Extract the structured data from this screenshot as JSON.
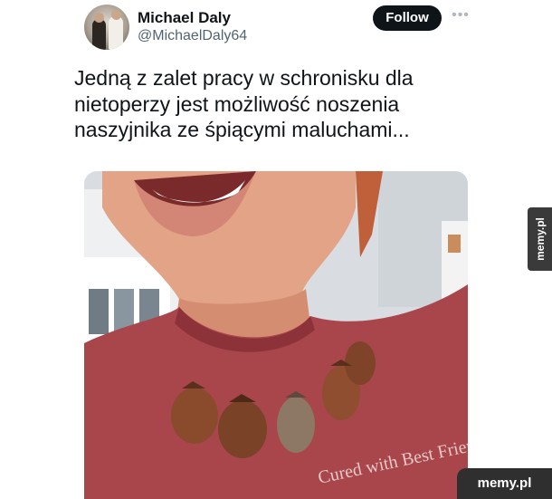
{
  "tweet": {
    "author": {
      "display_name": "Michael Daly",
      "handle": "@MichaelDaly64",
      "avatar_icon": "profile-photo"
    },
    "follow_label": "Follow",
    "more_icon": "more-horizontal-icon",
    "more_glyph": "•••",
    "text": "Jedną z zalet pracy w schronisku dla\nnietoperzy jest możliwość noszenia\nnaszyjnika ze śpiącymi maluchami...",
    "media": {
      "description_icon": "photo",
      "shirt_print": "Cured with Best Friends"
    }
  },
  "watermarks": {
    "side": "memy.pl",
    "corner": "memy.pl"
  },
  "colors": {
    "text_primary": "#0f1419",
    "text_secondary": "#536471",
    "follow_bg": "#0f1419",
    "shirt": "#a8464c",
    "bats": "#8a4a2c"
  }
}
